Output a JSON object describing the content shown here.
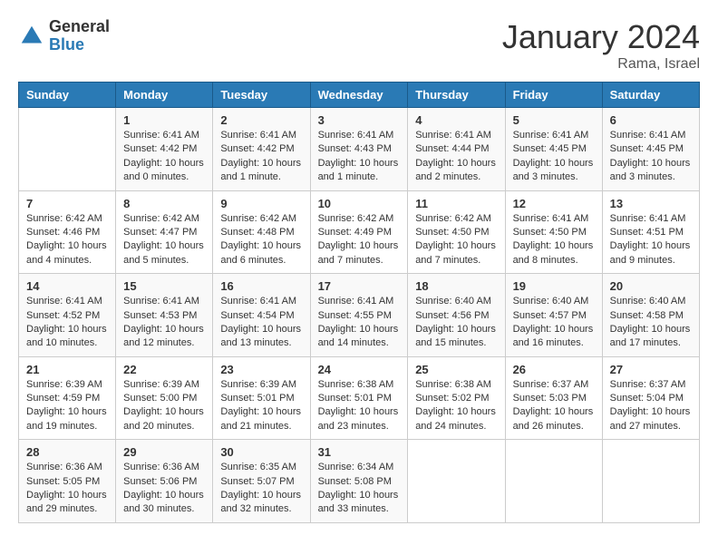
{
  "logo": {
    "general": "General",
    "blue": "Blue"
  },
  "title": "January 2024",
  "location": "Rama, Israel",
  "days_of_week": [
    "Sunday",
    "Monday",
    "Tuesday",
    "Wednesday",
    "Thursday",
    "Friday",
    "Saturday"
  ],
  "weeks": [
    [
      {
        "day": "",
        "sunrise": "",
        "sunset": "",
        "daylight": ""
      },
      {
        "day": "1",
        "sunrise": "Sunrise: 6:41 AM",
        "sunset": "Sunset: 4:42 PM",
        "daylight": "Daylight: 10 hours and 0 minutes."
      },
      {
        "day": "2",
        "sunrise": "Sunrise: 6:41 AM",
        "sunset": "Sunset: 4:42 PM",
        "daylight": "Daylight: 10 hours and 1 minute."
      },
      {
        "day": "3",
        "sunrise": "Sunrise: 6:41 AM",
        "sunset": "Sunset: 4:43 PM",
        "daylight": "Daylight: 10 hours and 1 minute."
      },
      {
        "day": "4",
        "sunrise": "Sunrise: 6:41 AM",
        "sunset": "Sunset: 4:44 PM",
        "daylight": "Daylight: 10 hours and 2 minutes."
      },
      {
        "day": "5",
        "sunrise": "Sunrise: 6:41 AM",
        "sunset": "Sunset: 4:45 PM",
        "daylight": "Daylight: 10 hours and 3 minutes."
      },
      {
        "day": "6",
        "sunrise": "Sunrise: 6:41 AM",
        "sunset": "Sunset: 4:45 PM",
        "daylight": "Daylight: 10 hours and 3 minutes."
      }
    ],
    [
      {
        "day": "7",
        "sunrise": "Sunrise: 6:42 AM",
        "sunset": "Sunset: 4:46 PM",
        "daylight": "Daylight: 10 hours and 4 minutes."
      },
      {
        "day": "8",
        "sunrise": "Sunrise: 6:42 AM",
        "sunset": "Sunset: 4:47 PM",
        "daylight": "Daylight: 10 hours and 5 minutes."
      },
      {
        "day": "9",
        "sunrise": "Sunrise: 6:42 AM",
        "sunset": "Sunset: 4:48 PM",
        "daylight": "Daylight: 10 hours and 6 minutes."
      },
      {
        "day": "10",
        "sunrise": "Sunrise: 6:42 AM",
        "sunset": "Sunset: 4:49 PM",
        "daylight": "Daylight: 10 hours and 7 minutes."
      },
      {
        "day": "11",
        "sunrise": "Sunrise: 6:42 AM",
        "sunset": "Sunset: 4:50 PM",
        "daylight": "Daylight: 10 hours and 7 minutes."
      },
      {
        "day": "12",
        "sunrise": "Sunrise: 6:41 AM",
        "sunset": "Sunset: 4:50 PM",
        "daylight": "Daylight: 10 hours and 8 minutes."
      },
      {
        "day": "13",
        "sunrise": "Sunrise: 6:41 AM",
        "sunset": "Sunset: 4:51 PM",
        "daylight": "Daylight: 10 hours and 9 minutes."
      }
    ],
    [
      {
        "day": "14",
        "sunrise": "Sunrise: 6:41 AM",
        "sunset": "Sunset: 4:52 PM",
        "daylight": "Daylight: 10 hours and 10 minutes."
      },
      {
        "day": "15",
        "sunrise": "Sunrise: 6:41 AM",
        "sunset": "Sunset: 4:53 PM",
        "daylight": "Daylight: 10 hours and 12 minutes."
      },
      {
        "day": "16",
        "sunrise": "Sunrise: 6:41 AM",
        "sunset": "Sunset: 4:54 PM",
        "daylight": "Daylight: 10 hours and 13 minutes."
      },
      {
        "day": "17",
        "sunrise": "Sunrise: 6:41 AM",
        "sunset": "Sunset: 4:55 PM",
        "daylight": "Daylight: 10 hours and 14 minutes."
      },
      {
        "day": "18",
        "sunrise": "Sunrise: 6:40 AM",
        "sunset": "Sunset: 4:56 PM",
        "daylight": "Daylight: 10 hours and 15 minutes."
      },
      {
        "day": "19",
        "sunrise": "Sunrise: 6:40 AM",
        "sunset": "Sunset: 4:57 PM",
        "daylight": "Daylight: 10 hours and 16 minutes."
      },
      {
        "day": "20",
        "sunrise": "Sunrise: 6:40 AM",
        "sunset": "Sunset: 4:58 PM",
        "daylight": "Daylight: 10 hours and 17 minutes."
      }
    ],
    [
      {
        "day": "21",
        "sunrise": "Sunrise: 6:39 AM",
        "sunset": "Sunset: 4:59 PM",
        "daylight": "Daylight: 10 hours and 19 minutes."
      },
      {
        "day": "22",
        "sunrise": "Sunrise: 6:39 AM",
        "sunset": "Sunset: 5:00 PM",
        "daylight": "Daylight: 10 hours and 20 minutes."
      },
      {
        "day": "23",
        "sunrise": "Sunrise: 6:39 AM",
        "sunset": "Sunset: 5:01 PM",
        "daylight": "Daylight: 10 hours and 21 minutes."
      },
      {
        "day": "24",
        "sunrise": "Sunrise: 6:38 AM",
        "sunset": "Sunset: 5:01 PM",
        "daylight": "Daylight: 10 hours and 23 minutes."
      },
      {
        "day": "25",
        "sunrise": "Sunrise: 6:38 AM",
        "sunset": "Sunset: 5:02 PM",
        "daylight": "Daylight: 10 hours and 24 minutes."
      },
      {
        "day": "26",
        "sunrise": "Sunrise: 6:37 AM",
        "sunset": "Sunset: 5:03 PM",
        "daylight": "Daylight: 10 hours and 26 minutes."
      },
      {
        "day": "27",
        "sunrise": "Sunrise: 6:37 AM",
        "sunset": "Sunset: 5:04 PM",
        "daylight": "Daylight: 10 hours and 27 minutes."
      }
    ],
    [
      {
        "day": "28",
        "sunrise": "Sunrise: 6:36 AM",
        "sunset": "Sunset: 5:05 PM",
        "daylight": "Daylight: 10 hours and 29 minutes."
      },
      {
        "day": "29",
        "sunrise": "Sunrise: 6:36 AM",
        "sunset": "Sunset: 5:06 PM",
        "daylight": "Daylight: 10 hours and 30 minutes."
      },
      {
        "day": "30",
        "sunrise": "Sunrise: 6:35 AM",
        "sunset": "Sunset: 5:07 PM",
        "daylight": "Daylight: 10 hours and 32 minutes."
      },
      {
        "day": "31",
        "sunrise": "Sunrise: 6:34 AM",
        "sunset": "Sunset: 5:08 PM",
        "daylight": "Daylight: 10 hours and 33 minutes."
      },
      {
        "day": "",
        "sunrise": "",
        "sunset": "",
        "daylight": ""
      },
      {
        "day": "",
        "sunrise": "",
        "sunset": "",
        "daylight": ""
      },
      {
        "day": "",
        "sunrise": "",
        "sunset": "",
        "daylight": ""
      }
    ]
  ]
}
